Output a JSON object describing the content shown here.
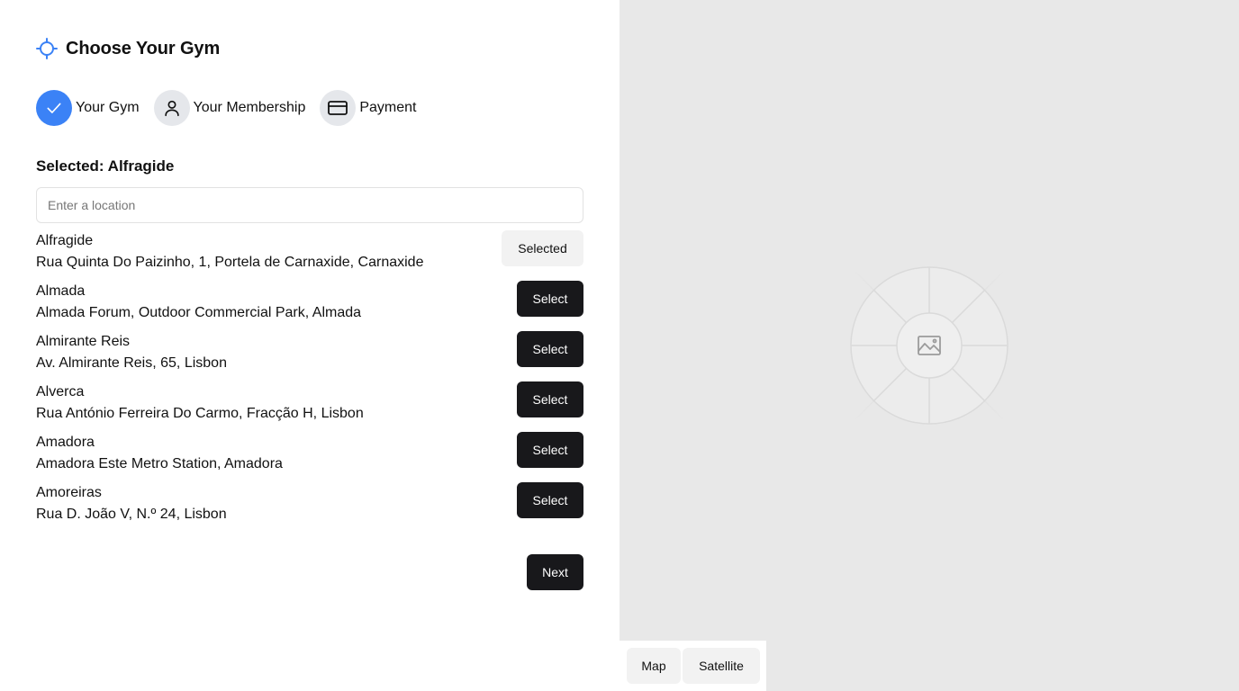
{
  "header": {
    "title": "Choose Your Gym",
    "icon": "crosshair-icon",
    "accent": "#3b82f6"
  },
  "steps": [
    {
      "label": "Your Gym",
      "icon": "check-icon",
      "state": "completed"
    },
    {
      "label": "Your Membership",
      "icon": "user-icon",
      "state": "pending"
    },
    {
      "label": "Payment",
      "icon": "credit-card-icon",
      "state": "pending"
    }
  ],
  "selection": {
    "label": "Selected: Alfragide"
  },
  "search": {
    "placeholder": "Enter a location",
    "value": ""
  },
  "gyms": [
    {
      "name": "Alfragide",
      "address": "Rua Quinta Do Paizinho, 1, Portela de Carnaxide, Carnaxide",
      "button": "Selected"
    },
    {
      "name": "Almada",
      "address": "Almada Forum, Outdoor Commercial Park, Almada",
      "button": "Select"
    },
    {
      "name": "Almirante Reis",
      "address": "Av. Almirante Reis, 65, Lisbon",
      "button": "Select"
    },
    {
      "name": "Alverca",
      "address": "Rua António Ferreira Do Carmo, Fracção H, Lisbon",
      "button": "Select"
    },
    {
      "name": "Amadora",
      "address": "Amadora Este Metro Station, Amadora",
      "button": "Select"
    },
    {
      "name": "Amoreiras",
      "address": "Rua D. João V, N.º 24, Lisbon",
      "button": "Select"
    }
  ],
  "footer": {
    "next_label": "Next"
  },
  "map": {
    "placeholder_icon": "image-icon",
    "toggle": {
      "map_label": "Map",
      "satellite_label": "Satellite"
    }
  }
}
